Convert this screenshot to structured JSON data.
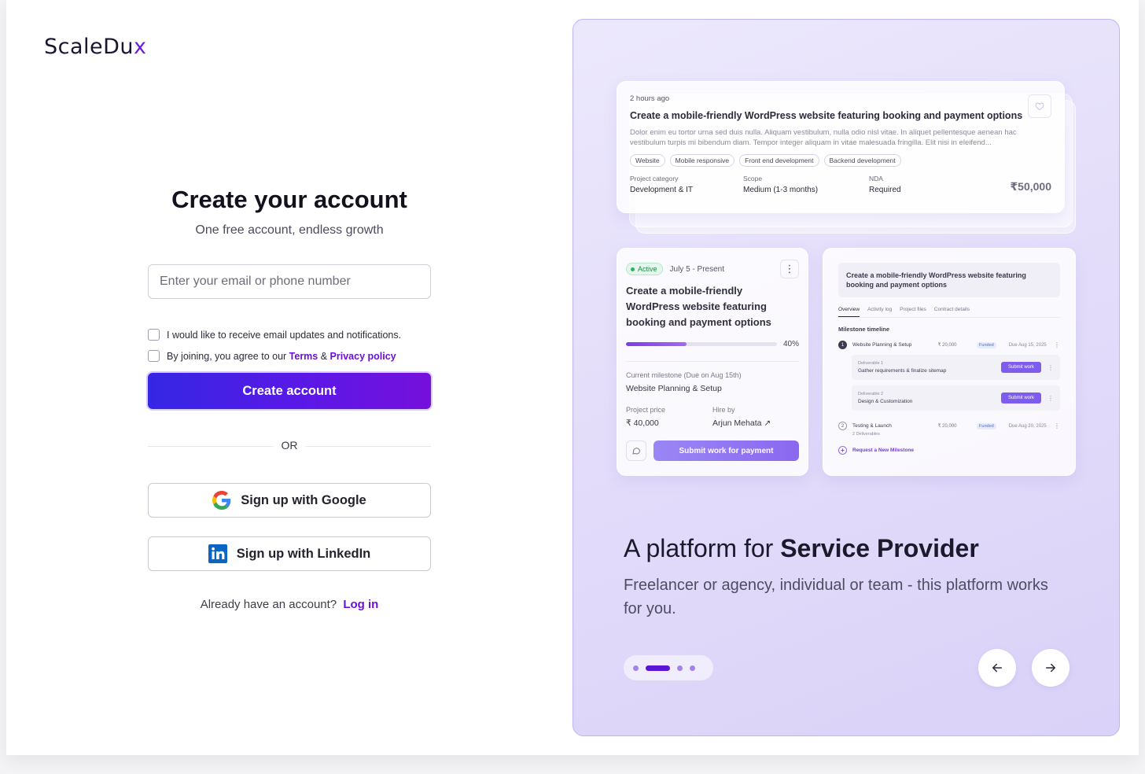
{
  "brand": {
    "logo_text": "ScaleDu",
    "logo_accent": "x",
    "accent_color": "#6a10d8"
  },
  "signup": {
    "title": "Create your account",
    "subtitle": "One free account, endless growth",
    "email_placeholder": "Enter your email or phone number",
    "email_value": "",
    "consent_updates": "I would like to receive email updates and notifications.",
    "consent_terms_prefix": "By joining, you agree to our ",
    "terms_link": "Terms",
    "ampersand": " & ",
    "privacy_link": "Privacy policy",
    "create_button": "Create account",
    "divider": "OR",
    "google_button": "Sign up with Google",
    "linkedin_button": "Sign up with LinkedIn",
    "login_prompt": "Already have an account?",
    "login_link": "Log in"
  },
  "preview": {
    "job_card": {
      "posted": "2 hours ago",
      "title": "Create a mobile-friendly WordPress website featuring booking and payment options",
      "description": "Dolor enim eu tortor urna sed duis nulla. Aliquam vestibulum, nulla odio nisl vitae. In aliquet pellentesque aenean hac vestibulum turpis mi bibendum diam. Tempor integer aliquam in vitae malesuada fringilla. Elit nisi in eleifend...",
      "tags": [
        "Website",
        "Mobile responsive",
        "Front end development",
        "Backend development"
      ],
      "category_label": "Project category",
      "category_value": "Development & IT",
      "scope_label": "Scope",
      "scope_value": "Medium (1-3 months)",
      "nda_label": "NDA",
      "nda_value": "Required",
      "price": "₹50,000"
    },
    "active_card": {
      "status": "Active",
      "dates": "July 5 - Present",
      "title": "Create a mobile-friendly WordPress website featuring booking and payment options",
      "progress": 40,
      "progress_label": "40%",
      "milestone_label": "Current milestone (Due on Aug 15th)",
      "milestone_value": "Website Planning & Setup",
      "price_label": "Project price",
      "price_value": "₹ 40,000",
      "hire_label": "Hire by",
      "hire_value": "Arjun Mehata",
      "submit_button": "Submit work for payment"
    },
    "detail_card": {
      "title": "Create a mobile-friendly WordPress website featuring booking and payment options",
      "tabs": [
        "Overview",
        "Activity log",
        "Project files",
        "Contract details"
      ],
      "section": "Milestone timeline",
      "milestones": [
        {
          "num": "1",
          "name": "Website Planning & Setup",
          "price": "₹ 20,000",
          "status": "Funded",
          "due": "Due Aug 15, 2025"
        },
        {
          "num": "2",
          "name": "Testing & Launch",
          "price": "₹ 20,000",
          "status": "Funded",
          "due": "Due Aug 20, 2025",
          "sub": "2 Deliverables"
        }
      ],
      "deliverables": [
        {
          "label": "Deliverable 1",
          "name": "Gather requirements & finalize sitemap",
          "button": "Submit work"
        },
        {
          "label": "Deliverable 2",
          "name": "Design & Customization",
          "button": "Submit work"
        }
      ],
      "request": "Request a New Milestone"
    }
  },
  "hero": {
    "title_prefix": "A platform for ",
    "title_bold": "Service Provider",
    "subtitle": "Freelancer or agency, individual or team - this platform works for you."
  },
  "carousel": {
    "active_index": 1,
    "count": 4
  }
}
